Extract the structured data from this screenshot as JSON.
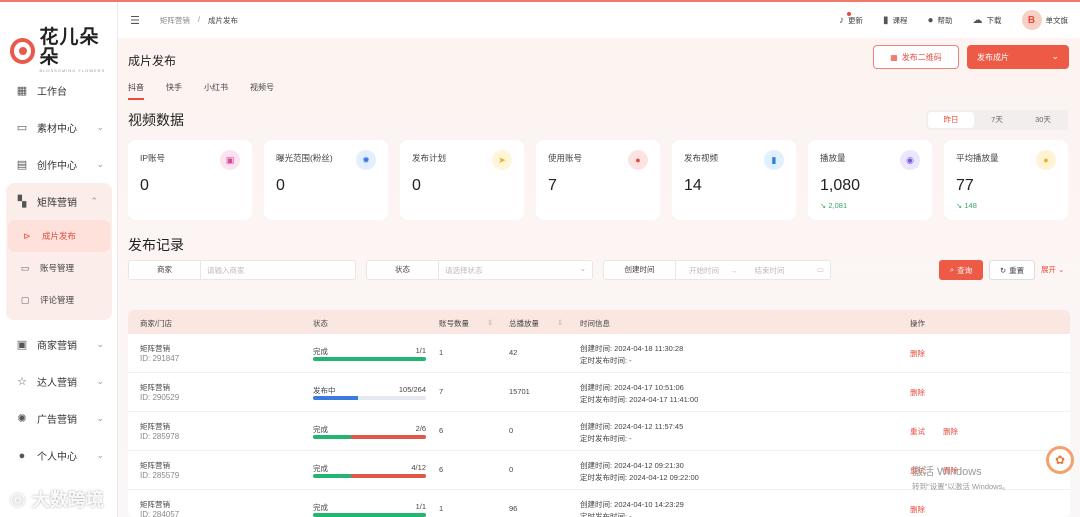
{
  "brand": {
    "title": "花儿朵朵",
    "subtitle": "BLOSSOMING FLOWERS"
  },
  "sidebar": {
    "items": [
      {
        "label": "工作台",
        "icon": "dashboard-icon",
        "glyph": "▦"
      },
      {
        "label": "素材中心",
        "icon": "folder-icon",
        "glyph": "▭"
      },
      {
        "label": "创作中心",
        "icon": "clapboard-icon",
        "glyph": "▤"
      }
    ],
    "group": {
      "label": "矩阵营销",
      "icon": "matrix-icon",
      "glyph": "▚",
      "children": [
        {
          "label": "成片发布",
          "icon": "publish-icon",
          "glyph": "⊳",
          "active": true
        },
        {
          "label": "账号管理",
          "icon": "monitor-icon",
          "glyph": "▭"
        },
        {
          "label": "评论管理",
          "icon": "comment-icon",
          "glyph": "▢"
        }
      ]
    },
    "items2": [
      {
        "label": "商家营销",
        "icon": "store-icon",
        "glyph": "▣"
      },
      {
        "label": "达人营销",
        "icon": "star-icon",
        "glyph": "☆"
      },
      {
        "label": "广告营销",
        "icon": "ad-icon",
        "glyph": "✺"
      },
      {
        "label": "个人中心",
        "icon": "user-icon",
        "glyph": "●"
      }
    ]
  },
  "topbar": {
    "breadcrumb": [
      "矩阵营销",
      "/",
      "成片发布"
    ],
    "actions": [
      {
        "label": "更新",
        "icon": "bell-icon",
        "glyph": "♪"
      },
      {
        "label": "课程",
        "icon": "book-icon",
        "glyph": "▮"
      },
      {
        "label": "帮助",
        "icon": "chat-icon",
        "glyph": "●"
      },
      {
        "label": "下载",
        "icon": "cloud-download-icon",
        "glyph": "☁"
      }
    ],
    "user": {
      "name": "单文旗",
      "avatar_glyph": "B"
    }
  },
  "page": {
    "title": "成片发布",
    "btn_qr": "发布二维码",
    "btn_publish": "发布成片",
    "tabs": [
      "抖音",
      "快手",
      "小红书",
      "视频号"
    ],
    "video_section": "视频数据",
    "range": [
      "昨日",
      "7天",
      "30天"
    ],
    "records_section": "发布记录"
  },
  "stats": [
    {
      "label": "IP账号",
      "value": "0",
      "delta": "",
      "icon": "id-card-icon",
      "glyph": "▣",
      "bg": "#fbe3f0",
      "fg": "#d84a9a"
    },
    {
      "label": "曝光范围(粉丝)",
      "value": "0",
      "delta": "",
      "icon": "sun-icon",
      "glyph": "✹",
      "bg": "#e3efff",
      "fg": "#3d7be8"
    },
    {
      "label": "发布计划",
      "value": "0",
      "delta": "",
      "icon": "paper-plane-icon",
      "glyph": "➤",
      "bg": "#fff6d9",
      "fg": "#e8b21a"
    },
    {
      "label": "使用账号",
      "value": "7",
      "delta": "",
      "icon": "person-icon",
      "glyph": "●",
      "bg": "#fde3e3",
      "fg": "#e84b3c"
    },
    {
      "label": "发布视频",
      "value": "14",
      "delta": "",
      "icon": "phone-icon",
      "glyph": "▮",
      "bg": "#e1f0ff",
      "fg": "#2f7fe0"
    },
    {
      "label": "播放量",
      "value": "1,080",
      "delta": "↘ 2,081",
      "icon": "eye-icon",
      "glyph": "◉",
      "bg": "#ece6ff",
      "fg": "#7a5ae0"
    },
    {
      "label": "平均播放量",
      "value": "77",
      "delta": "↘ 148",
      "icon": "coin-icon",
      "glyph": "●",
      "bg": "#fff3d6",
      "fg": "#f0b020"
    }
  ],
  "filters": {
    "merchant_label": "商家",
    "merchant_placeholder": "请输入商家",
    "status_label": "状态",
    "status_placeholder": "请选择状态",
    "date_label": "创建时间",
    "start_placeholder": "开始时间",
    "arrow": "→",
    "end_placeholder": "结束时间",
    "search": "查询",
    "reset": "重置",
    "expand": "展开"
  },
  "table": {
    "headers": [
      "商家/门店",
      "状态",
      "账号数量",
      "总播放量",
      "时间信息",
      "操作"
    ],
    "rows": [
      {
        "name": "矩阵营销",
        "id": "ID: 291847",
        "status": "完成",
        "frac": "1/1",
        "green": 1.0,
        "red": 0,
        "blue": 0,
        "accounts": "1",
        "plays": "42",
        "created": "创建时间: 2024-04-18 11:30:28",
        "scheduled": "定时发布时间: -",
        "ops": [
          "删除"
        ]
      },
      {
        "name": "矩阵营销",
        "id": "ID: 290529",
        "status": "发布中",
        "frac": "105/264",
        "green": 0,
        "red": 0,
        "blue": 0.398,
        "accounts": "7",
        "plays": "15701",
        "created": "创建时间: 2024-04-17 10:51:06",
        "scheduled": "定时发布时间: 2024-04-17 11:41:00",
        "ops": [
          "删除"
        ]
      },
      {
        "name": "矩阵营销",
        "id": "ID: 285978",
        "status": "完成",
        "frac": "2/6",
        "green": 0.333,
        "red": 0.667,
        "blue": 0,
        "accounts": "6",
        "plays": "0",
        "created": "创建时间: 2024-04-12 11:57:45",
        "scheduled": "定时发布时间: -",
        "ops": [
          "重试",
          "删除"
        ]
      },
      {
        "name": "矩阵营销",
        "id": "ID: 285579",
        "status": "完成",
        "frac": "4/12",
        "green": 0.333,
        "red": 0.667,
        "blue": 0,
        "accounts": "6",
        "plays": "0",
        "created": "创建时间: 2024-04-12 09:21:30",
        "scheduled": "定时发布时间: 2024-04-12 09:22:00",
        "ops": [
          "重试",
          "删除"
        ]
      },
      {
        "name": "矩阵营销",
        "id": "ID: 284057",
        "status": "完成",
        "frac": "1/1",
        "green": 1.0,
        "red": 0,
        "blue": 0,
        "accounts": "1",
        "plays": "96",
        "created": "创建时间: 2024-04-10 14:23:29",
        "scheduled": "定时发布时间: -",
        "ops": [
          "删除"
        ]
      }
    ]
  },
  "overlay": {
    "windows_line1": "激活 Windows",
    "windows_line2": "转到\"设置\"以激活 Windows。",
    "brand_watermark": "大数跨境"
  },
  "colors": {
    "accent": "#ed5a46",
    "success": "#22b573",
    "danger": "#e0584a",
    "progress": "#3b7be0"
  }
}
